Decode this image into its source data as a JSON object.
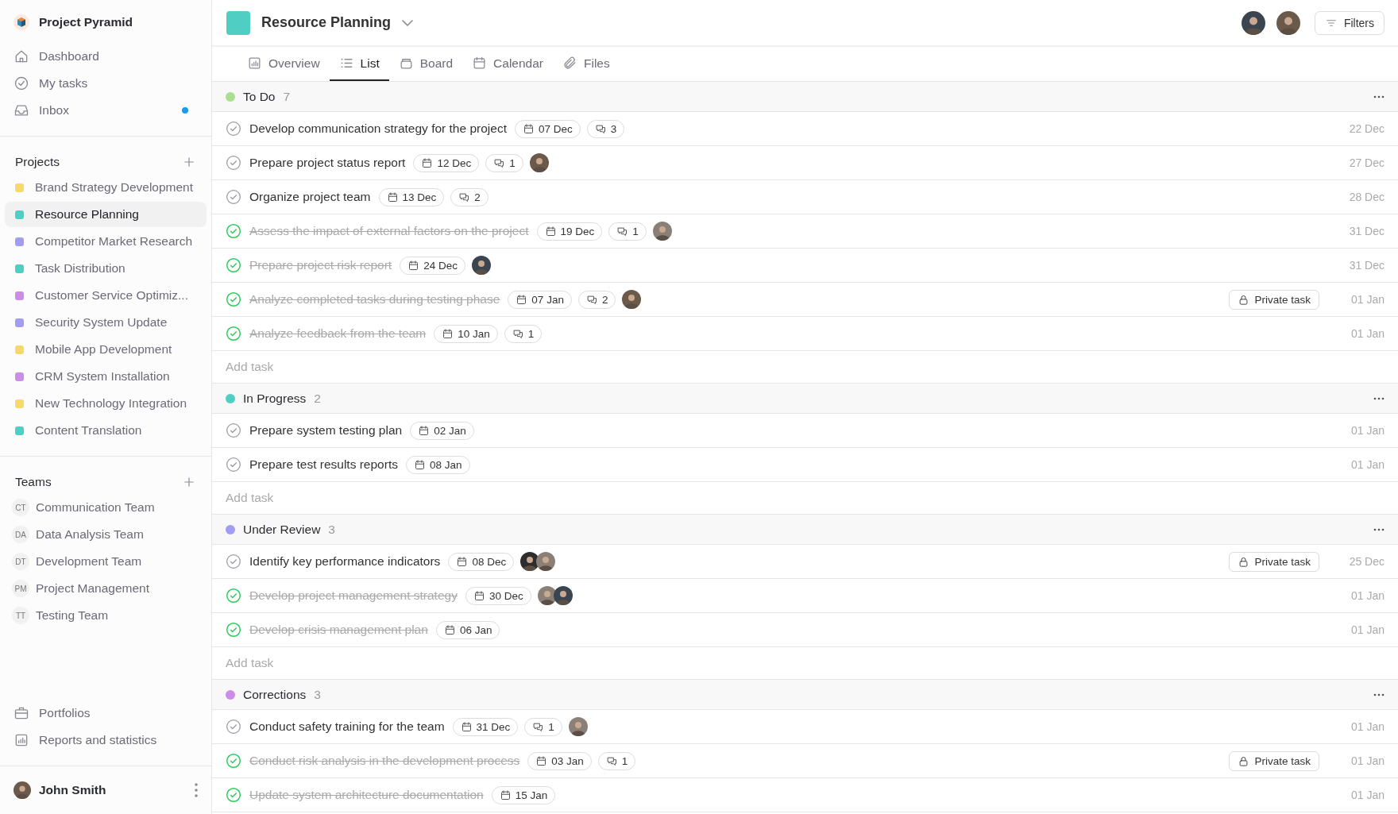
{
  "app": {
    "name": "Project Pyramid"
  },
  "nav": [
    {
      "label": "Dashboard",
      "unread": false
    },
    {
      "label": "My tasks",
      "unread": false
    },
    {
      "label": "Inbox",
      "unread": true
    }
  ],
  "projects": {
    "title": "Projects",
    "items": [
      {
        "name": "Brand Strategy Development",
        "color": "#f7d96b",
        "selected": false
      },
      {
        "name": "Resource Planning",
        "color": "#4fcfc3",
        "selected": true
      },
      {
        "name": "Competitor Market Research",
        "color": "#a39cf4",
        "selected": false
      },
      {
        "name": "Task Distribution",
        "color": "#4fcfc3",
        "selected": false
      },
      {
        "name": "Customer Service Optimiz...",
        "color": "#cc8de8",
        "selected": false
      },
      {
        "name": "Security System Update",
        "color": "#a39cf4",
        "selected": false
      },
      {
        "name": "Mobile App Development",
        "color": "#f7d96b",
        "selected": false
      },
      {
        "name": "CRM System Installation",
        "color": "#cc8de8",
        "selected": false
      },
      {
        "name": "New Technology Integration",
        "color": "#f7d96b",
        "selected": false
      },
      {
        "name": "Content Translation",
        "color": "#4fcfc3",
        "selected": false
      }
    ]
  },
  "teams": {
    "title": "Teams",
    "items": [
      {
        "initials": "CT",
        "name": "Communication Team"
      },
      {
        "initials": "DA",
        "name": "Data Analysis Team"
      },
      {
        "initials": "DT",
        "name": "Development Team"
      },
      {
        "initials": "PM",
        "name": "Project Management"
      },
      {
        "initials": "TT",
        "name": "Testing Team"
      }
    ]
  },
  "bottom_nav": [
    {
      "label": "Portfolios"
    },
    {
      "label": "Reports and statistics"
    }
  ],
  "user": {
    "name": "John Smith"
  },
  "header": {
    "title": "Resource Planning",
    "color": "#4fcfc3",
    "filters": "Filters"
  },
  "tabs": [
    {
      "label": "Overview",
      "selected": false
    },
    {
      "label": "List",
      "selected": true
    },
    {
      "label": "Board",
      "selected": false
    },
    {
      "label": "Calendar",
      "selected": false
    },
    {
      "label": "Files",
      "selected": false
    }
  ],
  "groups": [
    {
      "name": "To Do",
      "count": "7",
      "color": "#a8e08f",
      "add_task": "Add task",
      "tasks": [
        {
          "title": "Develop communication strategy for the project",
          "done": false,
          "due": "07 Dec",
          "comments": "3",
          "date": "22 Dec"
        },
        {
          "title": "Prepare project status report",
          "done": false,
          "due": "12 Dec",
          "comments": "1",
          "date": "27 Dec"
        },
        {
          "title": "Organize project team",
          "done": false,
          "due": "13 Dec",
          "comments": "2",
          "date": "28 Dec"
        },
        {
          "title": "Assess the impact of external factors on the project",
          "done": true,
          "due": "19 Dec",
          "comments": "1",
          "date": "31 Dec"
        },
        {
          "title": "Prepare project risk report",
          "done": true,
          "due": "24 Dec",
          "date": "31 Dec"
        },
        {
          "title": "Analyze completed tasks during testing phase",
          "done": true,
          "due": "07 Jan",
          "comments": "2",
          "private": "Private task",
          "date": "01 Jan"
        },
        {
          "title": "Analyze feedback from the team",
          "done": true,
          "due": "10 Jan",
          "comments": "1",
          "date": "01 Jan"
        }
      ]
    },
    {
      "name": "In Progress",
      "count": "2",
      "color": "#4fcfc3",
      "add_task": "Add task",
      "tasks": [
        {
          "title": "Prepare system testing plan",
          "done": false,
          "due": "02 Jan",
          "date": "01 Jan"
        },
        {
          "title": "Prepare test results reports",
          "done": false,
          "due": "08 Jan",
          "date": "01 Jan"
        }
      ]
    },
    {
      "name": "Under Review",
      "count": "3",
      "color": "#a39cf4",
      "add_task": "Add task",
      "tasks": [
        {
          "title": "Identify key performance indicators",
          "done": false,
          "due": "08 Dec",
          "private": "Private task",
          "date": "25 Dec"
        },
        {
          "title": "Develop project management strategy",
          "done": true,
          "due": "30 Dec",
          "date": "01 Jan"
        },
        {
          "title": "Develop crisis management plan",
          "done": true,
          "due": "06 Jan",
          "date": "01 Jan"
        }
      ]
    },
    {
      "name": "Corrections",
      "count": "3",
      "color": "#cc8de8",
      "tasks": [
        {
          "title": "Conduct safety training for the team",
          "done": false,
          "due": "31 Dec",
          "comments": "1",
          "date": "01 Jan"
        },
        {
          "title": "Conduct risk analysis in the development process",
          "done": true,
          "due": "03 Jan",
          "comments": "1",
          "private": "Private task",
          "date": "01 Jan"
        },
        {
          "title": "Update system architecture documentation",
          "done": true,
          "due": "15 Jan",
          "date": "01 Jan"
        }
      ]
    }
  ]
}
